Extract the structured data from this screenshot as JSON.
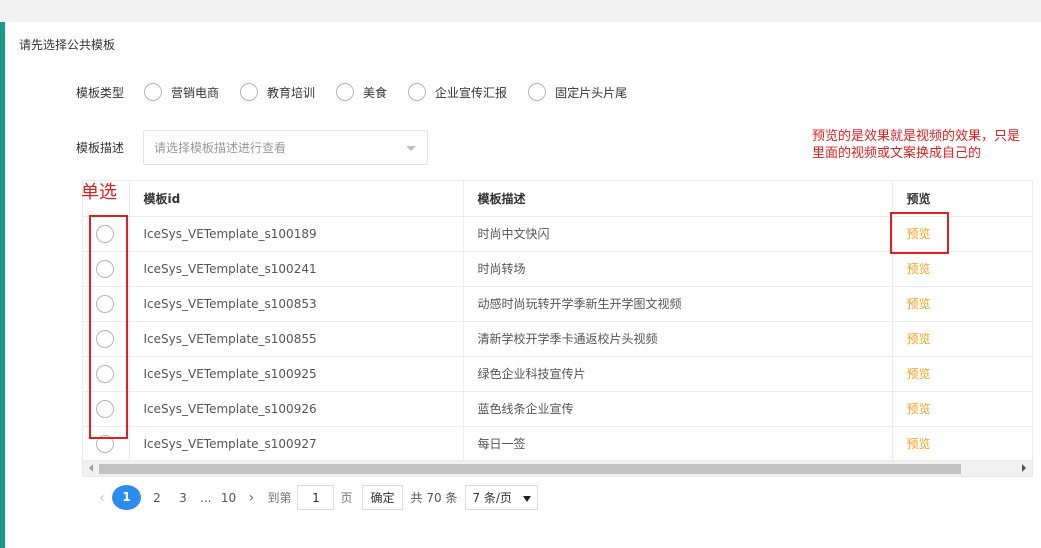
{
  "colors": {
    "accent": "#1a9a8a",
    "preview_link": "#f0a020",
    "page_active": "#2d8cf0",
    "annotation": "#e02020"
  },
  "section_title": "请先选择公共模板",
  "template_type": {
    "label": "模板类型",
    "options": [
      "营销电商",
      "教育培训",
      "美食",
      "企业宣传汇报",
      "固定片头片尾"
    ]
  },
  "template_desc": {
    "label": "模板描述",
    "placeholder": "请选择模板描述进行查看"
  },
  "table": {
    "headers": {
      "id": "模板id",
      "desc": "模板描述",
      "preview": "预览"
    },
    "rows": [
      {
        "id": "IceSys_VETemplate_s100189",
        "desc": "时尚中文快闪",
        "preview": "预览"
      },
      {
        "id": "IceSys_VETemplate_s100241",
        "desc": "时尚转场",
        "preview": "预览"
      },
      {
        "id": "IceSys_VETemplate_s100853",
        "desc": "动感时尚玩转开学季新生开学图文视频",
        "preview": "预览"
      },
      {
        "id": "IceSys_VETemplate_s100855",
        "desc": "清新学校开学季卡通返校片头视频",
        "preview": "预览"
      },
      {
        "id": "IceSys_VETemplate_s100925",
        "desc": "绿色企业科技宣传片",
        "preview": "预览"
      },
      {
        "id": "IceSys_VETemplate_s100926",
        "desc": "蓝色线条企业宣传",
        "preview": "预览"
      },
      {
        "id": "IceSys_VETemplate_s100927",
        "desc": "每日一签",
        "preview": "预览"
      }
    ]
  },
  "pagination": {
    "pages": [
      "1",
      "2",
      "3"
    ],
    "ellipsis": "...",
    "last_page": "10",
    "goto_label": "到第",
    "goto_value": "1",
    "page_unit": "页",
    "confirm_label": "确定",
    "total_text": "共 70 条",
    "page_size": "7 条/页"
  },
  "annotations": {
    "single_select": "单选",
    "note": "预览的是效果就是视频的效果，只是里面的视频或文案换成自己的"
  }
}
